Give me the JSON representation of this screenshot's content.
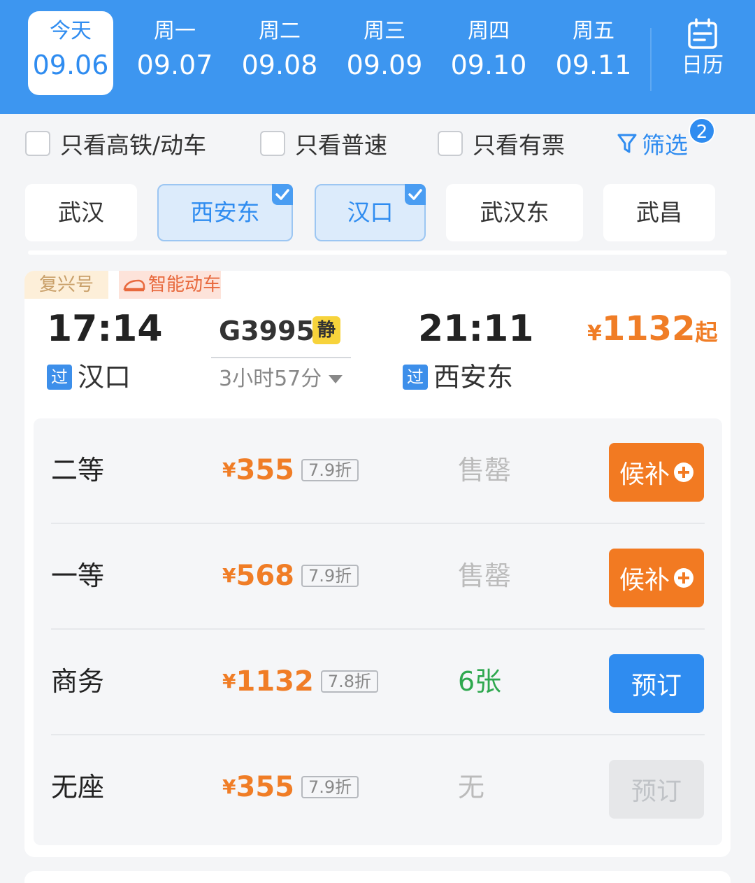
{
  "dates": [
    {
      "weekday": "今天",
      "date": "09.06",
      "active": true
    },
    {
      "weekday": "周一",
      "date": "09.07"
    },
    {
      "weekday": "周二",
      "date": "09.08"
    },
    {
      "weekday": "周三",
      "date": "09.09"
    },
    {
      "weekday": "周四",
      "date": "09.10"
    },
    {
      "weekday": "周五",
      "date": "09.11"
    }
  ],
  "calendar": {
    "label": "日历",
    "icon": "calendar-icon"
  },
  "filters": {
    "high_speed": "只看高铁/动车",
    "normal": "只看普速",
    "available": "只看有票",
    "screen": "筛选",
    "screen_badge": "2"
  },
  "stations": [
    {
      "name": "武汉",
      "selected": false
    },
    {
      "name": "西安东",
      "selected": true
    },
    {
      "name": "汉口",
      "selected": true
    },
    {
      "name": "武汉东",
      "selected": false
    },
    {
      "name": "武昌",
      "selected": false
    }
  ],
  "train": {
    "tag_fuxing": "复兴号",
    "tag_smart": "智能动车",
    "dep_time": "17:14",
    "dep_station": "汉口",
    "via_label": "过",
    "number": "G3995",
    "quiet_label": "静",
    "duration": "3小时57分",
    "arr_time": "21:11",
    "arr_station": "西安东",
    "price_symbol": "¥",
    "price_from": "1132",
    "price_suffix": "起"
  },
  "seats": [
    {
      "name": "二等",
      "symbol": "¥",
      "price": "355",
      "discount": "7.9折",
      "status": "售罄",
      "action": "候补",
      "action_type": "wait"
    },
    {
      "name": "一等",
      "symbol": "¥",
      "price": "568",
      "discount": "7.9折",
      "status": "售罄",
      "action": "候补",
      "action_type": "wait"
    },
    {
      "name": "商务",
      "symbol": "¥",
      "price": "1132",
      "discount": "7.8折",
      "status": "6张",
      "action": "预订",
      "action_type": "book"
    },
    {
      "name": "无座",
      "symbol": "¥",
      "price": "355",
      "discount": "7.9折",
      "status": "无",
      "action": "预订",
      "action_type": "off"
    }
  ],
  "colors": {
    "brand_blue": "#3d96f0",
    "price_orange": "#f07d26",
    "wait_orange": "#f27a22",
    "available_green": "#2fa84f"
  }
}
